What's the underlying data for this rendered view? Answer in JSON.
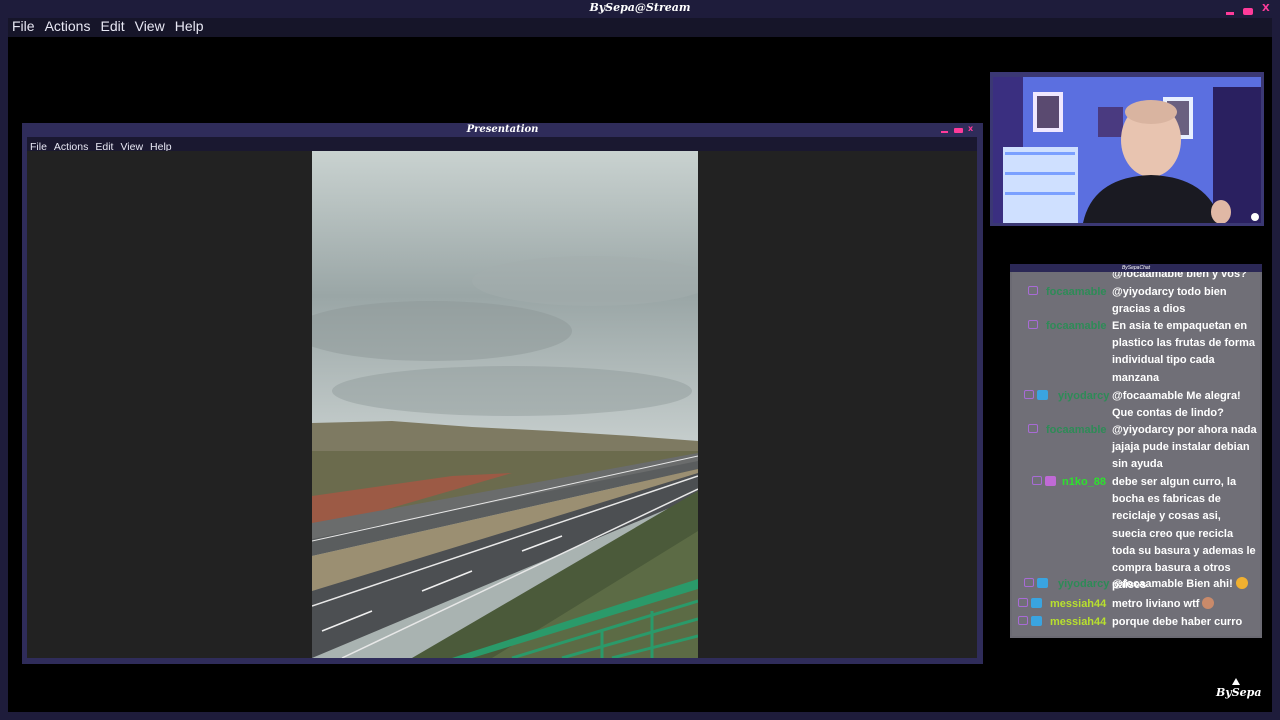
{
  "app": {
    "title": "BySepa@Stream",
    "menu": [
      "File",
      "Actions",
      "Edit",
      "View",
      "Help"
    ],
    "window_controls": {
      "close": "X"
    },
    "colors": {
      "frame": "#1e1c3b",
      "accent": "#ff3b9a",
      "menu_bg": "#161529"
    }
  },
  "presentation": {
    "title": "Presentation",
    "menu": [
      "File",
      "Actions",
      "Edit",
      "View",
      "Help"
    ],
    "window_controls": {
      "close": "x"
    }
  },
  "chat": {
    "title": "BySepaChat",
    "messages": [
      {
        "user": "",
        "user_color": "#4fc08d",
        "badges": [],
        "text": "@focaamable bien y vos?",
        "partial": true
      },
      {
        "user": "focaamable",
        "user_color": "#2e8b57",
        "badges": [
          "chat-bubble"
        ],
        "text": "@yiyodarcy todo bien gracias a dios"
      },
      {
        "user": "focaamable",
        "user_color": "#2e8b57",
        "badges": [
          "chat-bubble"
        ],
        "text": "En asia te empaquetan en plastico las frutas de forma individual tipo cada manzana"
      },
      {
        "user": "yiyodarcy",
        "user_color": "#2e8b57",
        "badges": [
          "chat-bubble",
          "crown"
        ],
        "text": "@focaamable Me alegra! Que contas de lindo?"
      },
      {
        "user": "focaamable",
        "user_color": "#2e8b57",
        "badges": [
          "chat-bubble"
        ],
        "text": "@yiyodarcy por ahora nada jajaja pude instalar debian sin ayuda"
      },
      {
        "user": "n1ko_88",
        "user_color": "#2ee02e",
        "badges": [
          "chat-bubble",
          "subscriber"
        ],
        "text": "debe ser algun curro, la bocha es fabricas de reciclaje y cosas asi, suecia creo que recicla toda su basura y ademas le compra basura a otros paises"
      },
      {
        "user": "yiyodarcy",
        "user_color": "#2e8b57",
        "badges": [
          "chat-bubble",
          "crown"
        ],
        "text": "@focaamable Bien ahi!",
        "emote": "heart-eyes-emote"
      },
      {
        "user": "messiah44",
        "user_color": "#b8e02e",
        "badges": [
          "chat-bubble",
          "crown"
        ],
        "text": "metro liviano wtf",
        "emote": "face-emote"
      },
      {
        "user": "messiah44",
        "user_color": "#b8e02e",
        "badges": [
          "chat-bubble",
          "crown"
        ],
        "text": "porque debe haber curro"
      }
    ]
  },
  "logo": {
    "text": "BySepa"
  }
}
